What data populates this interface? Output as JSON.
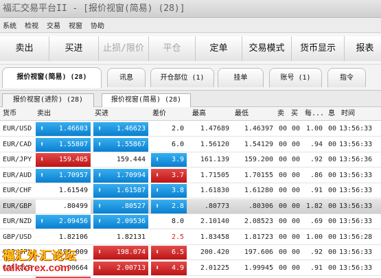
{
  "window": {
    "title": "福汇交易平台II - [报价视窗(简易) (28)]"
  },
  "menu": [
    "系统",
    "检视",
    "交易",
    "视窗",
    "协助"
  ],
  "toolbar": [
    "卖出",
    "买进",
    "止损/限价",
    "平仓",
    "定单",
    "交易模式",
    "货币显示",
    "报表"
  ],
  "toolbar_disabled": [
    false,
    false,
    true,
    true,
    false,
    false,
    false,
    false
  ],
  "tabs": [
    "报价视窗(简易) (28)",
    "讯息",
    "开仓部位 (1)",
    "挂单",
    "账号 (1)",
    "指令"
  ],
  "subtabs": [
    "报价视窗(进阶) (28)",
    "报价视窗(简易) (28)"
  ],
  "columns": [
    "货币",
    "卖出",
    "买进",
    "差价",
    "最高",
    "最低",
    "卖",
    "买",
    "每...",
    "息",
    "时间"
  ],
  "rows": [
    {
      "symbol": "EUR/USD",
      "sell": "1.46603",
      "buy": "1.46623",
      "sell_dir": "up",
      "buy_dir": "up",
      "spread": "2.0",
      "spread_dir": "none",
      "high": "1.47689",
      "low": "1.46397",
      "s": "00",
      "b": "00",
      "per": "1.00",
      "i": "00",
      "time": "13:56:33"
    },
    {
      "symbol": "EUR/CAD",
      "sell": "1.55807",
      "buy": "1.55867",
      "sell_dir": "up",
      "buy_dir": "up",
      "spread": "6.0",
      "spread_dir": "none",
      "high": "1.56120",
      "low": "1.54129",
      "s": "00",
      "b": "00",
      "per": ".94",
      "i": "00",
      "time": "13:56:33"
    },
    {
      "symbol": "EUR/JPY",
      "sell": "159.405",
      "buy": "159.444",
      "sell_dir": "down",
      "buy_dir": "none",
      "spread": "3.9",
      "spread_dir": "up",
      "high": "161.139",
      "low": "159.200",
      "s": "00",
      "b": "00",
      "per": ".92",
      "i": "00",
      "time": "13:56:36"
    },
    {
      "symbol": "EUR/AUD",
      "sell": "1.70957",
      "buy": "1.70994",
      "sell_dir": "up",
      "buy_dir": "up",
      "spread": "3.7",
      "spread_dir": "down",
      "high": "1.71505",
      "low": "1.70155",
      "s": "00",
      "b": "00",
      "per": ".86",
      "i": "00",
      "time": "13:56:33"
    },
    {
      "symbol": "EUR/CHF",
      "sell": "1.61549",
      "buy": "1.61587",
      "sell_dir": "none",
      "buy_dir": "up",
      "spread": "3.8",
      "spread_dir": "up",
      "high": "1.61830",
      "low": "1.61280",
      "s": "00",
      "b": "00",
      "per": ".91",
      "i": "00",
      "time": "13:56:33"
    },
    {
      "symbol": "EUR/GBP",
      "sell": ".80499",
      "buy": ".80527",
      "sell_dir": "none",
      "buy_dir": "up",
      "spread": "2.8",
      "spread_dir": "up",
      "high": ".80773",
      "low": ".80306",
      "s": "00",
      "b": "00",
      "per": "1.82",
      "i": "00",
      "time": "13:56:33",
      "selected": true
    },
    {
      "symbol": "EUR/NZD",
      "sell": "2.09456",
      "buy": "2.09536",
      "sell_dir": "up",
      "buy_dir": "up",
      "spread": "8.0",
      "spread_dir": "none",
      "high": "2.10140",
      "low": "2.08523",
      "s": "00",
      "b": "00",
      "per": ".69",
      "i": "00",
      "time": "13:56:33"
    },
    {
      "symbol": "GBP/USD",
      "sell": "1.82106",
      "buy": "1.82131",
      "sell_dir": "none",
      "buy_dir": "none",
      "spread": "2.5",
      "spread_dir": "none",
      "high": "1.83458",
      "low": "1.81723",
      "s": "00",
      "b": "00",
      "per": "1.00",
      "i": "00",
      "time": "13:56:28",
      "spread_red": true
    },
    {
      "symbol": "GBP/JPY",
      "sell": "198.009",
      "buy": "198.074",
      "sell_dir": "none",
      "buy_dir": "down",
      "spread": "6.5",
      "spread_dir": "down",
      "high": "200.420",
      "low": "197.606",
      "s": "00",
      "b": "00",
      "per": ".92",
      "i": "00",
      "time": "13:56:33"
    },
    {
      "symbol": "GBP/CHF",
      "sell": "2.00664",
      "buy": "2.00713",
      "sell_dir": "none",
      "buy_dir": "down",
      "spread": "4.9",
      "spread_dir": "down",
      "high": "2.01225",
      "low": "1.99945",
      "s": "00",
      "b": "00",
      "per": ".91",
      "i": "00",
      "time": "13:56:33"
    },
    {
      "symbol": "",
      "sell": "",
      "buy": "",
      "sell_dir": "down",
      "buy_dir": "none",
      "spread": "",
      "spread_dir": "none",
      "high": "",
      "low": "",
      "s": "",
      "b": "",
      "per": "",
      "i": "",
      "time": ""
    }
  ],
  "watermark": {
    "line1": "福汇外汇论坛",
    "line2": "talkforex.com"
  },
  "colors": {
    "up": "#1a8fe0",
    "down": "#d42424",
    "spread_red": "#e02020"
  }
}
